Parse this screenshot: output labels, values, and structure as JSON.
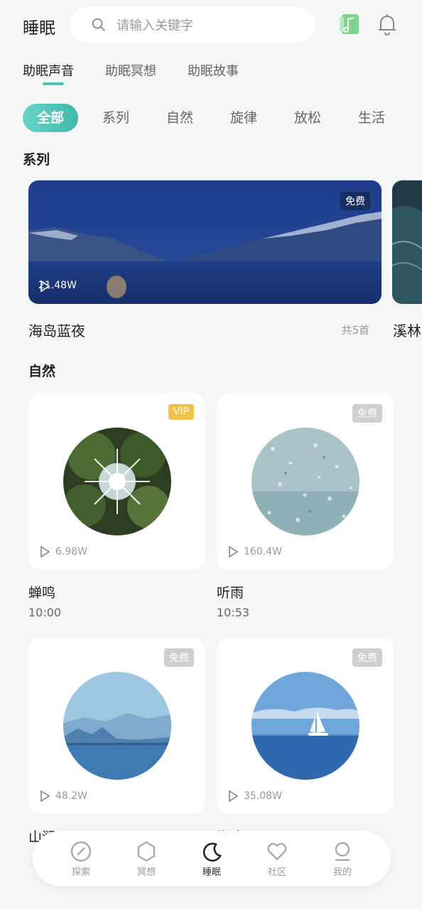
{
  "header": {
    "title": "睡眠",
    "search_placeholder": "请输入关键字"
  },
  "tabs": [
    {
      "label": "助眠声音",
      "active": true
    },
    {
      "label": "助眠冥想",
      "active": false
    },
    {
      "label": "助眠故事",
      "active": false
    }
  ],
  "chips": [
    {
      "label": "全部",
      "active": true
    },
    {
      "label": "系列",
      "active": false
    },
    {
      "label": "自然",
      "active": false
    },
    {
      "label": "旋律",
      "active": false
    },
    {
      "label": "放松",
      "active": false
    },
    {
      "label": "生活",
      "active": false
    }
  ],
  "series_section": {
    "title": "系列",
    "card": {
      "badge": "免费",
      "plays": "21.48W",
      "name": "海岛蓝夜",
      "count": "共5首"
    },
    "peek_name": "溪林"
  },
  "nature_section": {
    "title": "自然",
    "cards": [
      {
        "badge": "VIP",
        "plays": "6.98W",
        "title": "蝉鸣",
        "duration": "10:00"
      },
      {
        "badge": "免费",
        "plays": "160.4W",
        "title": "听雨",
        "duration": "10:53"
      },
      {
        "badge": "免费",
        "plays": "48.2W",
        "title": "山涧",
        "duration": ""
      },
      {
        "badge": "免费",
        "plays": "35.08W",
        "title": "海浪",
        "duration": ""
      }
    ]
  },
  "bottom_nav": [
    {
      "label": "探索",
      "icon": "compass-icon",
      "active": false
    },
    {
      "label": "冥想",
      "icon": "hexagon-icon",
      "active": false
    },
    {
      "label": "睡眠",
      "icon": "moon-icon",
      "active": true
    },
    {
      "label": "社区",
      "icon": "heart-icon",
      "active": false
    },
    {
      "label": "我的",
      "icon": "user-icon",
      "active": false
    }
  ],
  "colors": {
    "accent": "#4fc4b6",
    "vip": "#f2c14a",
    "background": "#f5f6f6"
  }
}
